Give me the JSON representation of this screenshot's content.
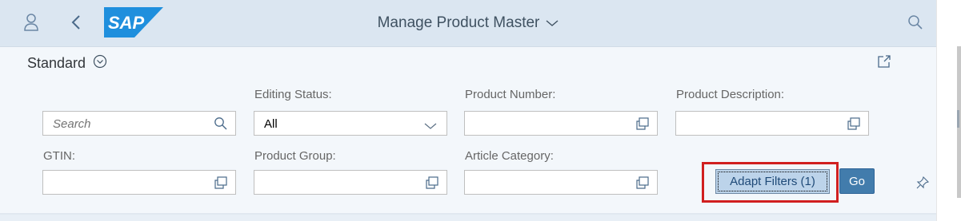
{
  "header": {
    "title": "Manage Product Master",
    "icons": [
      "user-icon",
      "back-icon",
      "sap-logo",
      "title-chevron-down-icon",
      "search-icon"
    ],
    "logo_text": "SAP"
  },
  "variant": {
    "name": "Standard"
  },
  "filters": {
    "search": {
      "placeholder": "Search"
    },
    "editing_status": {
      "label": "Editing Status:",
      "value": "All"
    },
    "product_number": {
      "label": "Product Number:",
      "value": ""
    },
    "product_description": {
      "label": "Product Description:",
      "value": ""
    },
    "gtin": {
      "label": "GTIN:",
      "value": ""
    },
    "product_group": {
      "label": "Product Group:",
      "value": ""
    },
    "article_category": {
      "label": "Article Category:",
      "value": ""
    }
  },
  "actions": {
    "adapt_filters": "Adapt Filters (1)",
    "go": "Go"
  },
  "colors": {
    "accent": "#427cac",
    "highlight": "#d11f1f",
    "header_bg": "#dbe6f1"
  }
}
